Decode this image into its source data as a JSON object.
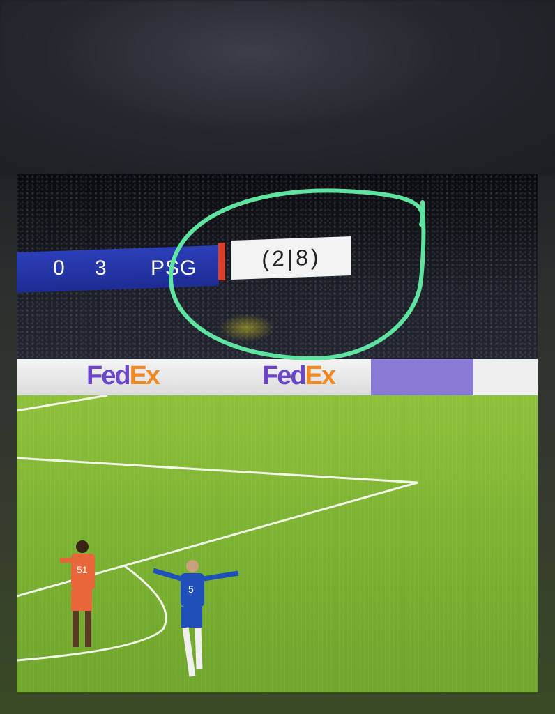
{
  "scoreboard": {
    "home_score": "0",
    "away_score": "3",
    "away_team": "PSG",
    "aggregate": "(2|8)"
  },
  "advertising": {
    "brand_fed": "Fed",
    "brand_ex": "Ex"
  },
  "players": {
    "orange_number": "51",
    "blue_number": "5"
  },
  "colors": {
    "scoreboard_blue": "#1d2c94",
    "highlight_green": "#5fe3a0",
    "pitch_green": "#7bb232"
  }
}
